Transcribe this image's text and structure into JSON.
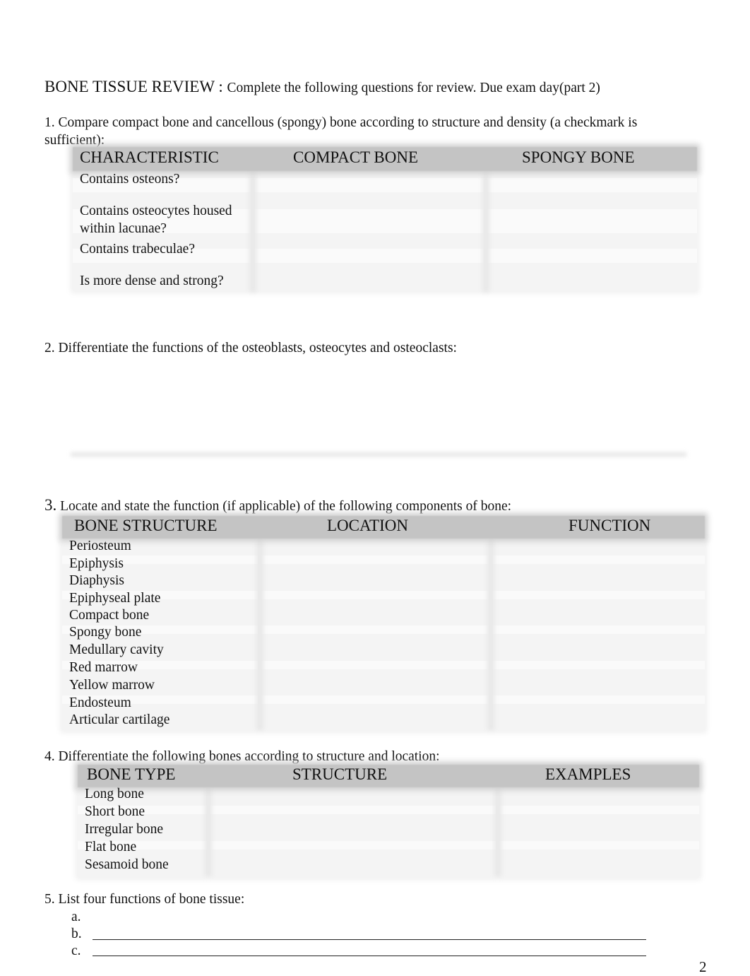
{
  "header": {
    "title": "BONE TISSUE REVIEW",
    "separator": " : ",
    "instructions": "Complete the following questions for review. Due exam day(part 2)"
  },
  "q1": {
    "prompt": "1.  Compare compact bone and cancellous (spongy) bone according to structure and density (a checkmark is",
    "prompt_cont": "sufficient):",
    "columns": [
      "CHARACTERISTIC",
      "COMPACT BONE",
      "SPONGY BONE"
    ],
    "rows": [
      [
        "Contains osteons?"
      ],
      [
        "Contains osteocytes housed",
        "within lacunae?"
      ],
      [
        "Contains trabeculae?"
      ],
      [
        "Is more dense and strong?"
      ]
    ]
  },
  "q2": {
    "prompt": "2. Differentiate the functions of the osteoblasts, osteocytes and osteoclasts:"
  },
  "q3": {
    "number": "3.",
    "prompt": " Locate and state the function (if applicable) of the following components of bone:",
    "columns": [
      "BONE STRUCTURE",
      "LOCATION",
      "FUNCTION"
    ],
    "rows": [
      "Periosteum",
      "Epiphysis",
      "Diaphysis",
      "Epiphyseal plate",
      "Compact bone",
      "Spongy bone",
      "Medullary cavity",
      "Red marrow",
      "Yellow marrow",
      "Endosteum",
      "Articular cartilage"
    ]
  },
  "q4": {
    "prompt": "4. Differentiate the following bones according to structure and location:",
    "columns": [
      "BONE TYPE",
      "STRUCTURE",
      "EXAMPLES"
    ],
    "rows": [
      "Long bone",
      "Short bone",
      "Irregular bone",
      "Flat bone",
      "Sesamoid bone"
    ]
  },
  "q5": {
    "prompt": "5. List four functions of bone tissue:",
    "items": [
      "a.",
      "b.",
      "c."
    ]
  },
  "page_number": "2"
}
